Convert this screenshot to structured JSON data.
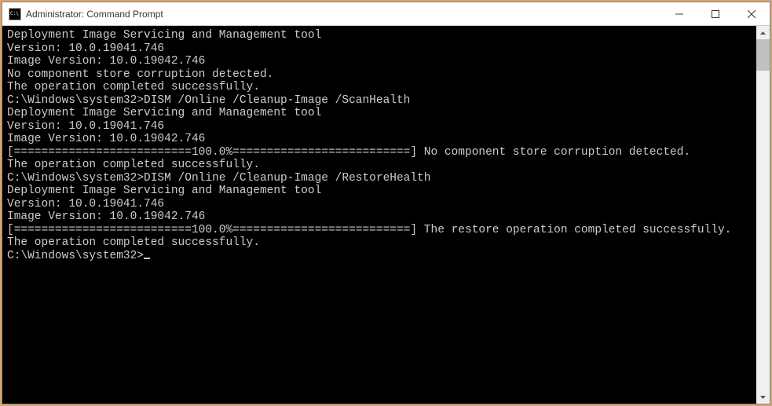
{
  "window": {
    "title": "Administrator: Command Prompt"
  },
  "terminal": {
    "lines": [
      "",
      "Deployment Image Servicing and Management tool",
      "Version: 10.0.19041.746",
      "",
      "Image Version: 10.0.19042.746",
      "",
      "No component store corruption detected.",
      "The operation completed successfully.",
      "",
      "C:\\Windows\\system32>DISM /Online /Cleanup-Image /ScanHealth",
      "",
      "Deployment Image Servicing and Management tool",
      "Version: 10.0.19041.746",
      "",
      "Image Version: 10.0.19042.746",
      "",
      "[==========================100.0%==========================] No component store corruption detected.",
      "The operation completed successfully.",
      "",
      "C:\\Windows\\system32>DISM /Online /Cleanup-Image /RestoreHealth",
      "",
      "Deployment Image Servicing and Management tool",
      "Version: 10.0.19041.746",
      "",
      "Image Version: 10.0.19042.746",
      "",
      "[==========================100.0%==========================] The restore operation completed successfully.",
      "The operation completed successfully.",
      "",
      "C:\\Windows\\system32>"
    ]
  }
}
